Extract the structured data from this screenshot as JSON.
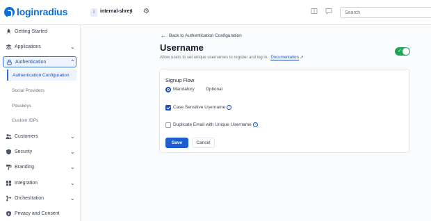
{
  "brand": {
    "name": "loginradius",
    "color": "#0a6fd6"
  },
  "app": {
    "chip": "i",
    "name": "internal-shrey"
  },
  "search": {
    "placeholder": "Search"
  },
  "sidebar": {
    "items": [
      {
        "label": "Getting Started",
        "icon": "rocket-icon"
      },
      {
        "label": "Applications",
        "icon": "layers-icon"
      },
      {
        "label": "Authentication",
        "icon": "lock-icon"
      },
      {
        "label": "Customers",
        "icon": "users-icon"
      },
      {
        "label": "Security",
        "icon": "shield-icon"
      },
      {
        "label": "Branding",
        "icon": "paint-roller-icon"
      },
      {
        "label": "Integration",
        "icon": "grid-icon"
      },
      {
        "label": "Orchestration",
        "icon": "workflow-icon"
      },
      {
        "label": "Privacy and Consent",
        "icon": "shield-lock-icon"
      }
    ],
    "sub_items": [
      {
        "label": "Authentication Configuration"
      },
      {
        "label": "Social Providers"
      },
      {
        "label": "Passkeys"
      },
      {
        "label": "Custom IDPs"
      }
    ]
  },
  "main": {
    "back_label": "Back to Authentication Configuration",
    "title": "Username",
    "description": "Allow users to set unique usernames to register and log in.",
    "doc_link": "Documentation",
    "enabled": true,
    "accent": "#1d4fb8",
    "toggle_color": "#22a35a"
  },
  "card": {
    "title": "Signup Flow",
    "radio_options": [
      {
        "label": "Mandatory",
        "selected": true
      },
      {
        "label": "Optional",
        "selected": false
      }
    ],
    "checkboxes": [
      {
        "label": "Case Sensitive Username",
        "checked": true
      },
      {
        "label": "Duplicate Email with Unique Username",
        "checked": false
      }
    ],
    "save_label": "Save",
    "cancel_label": "Cancel"
  }
}
